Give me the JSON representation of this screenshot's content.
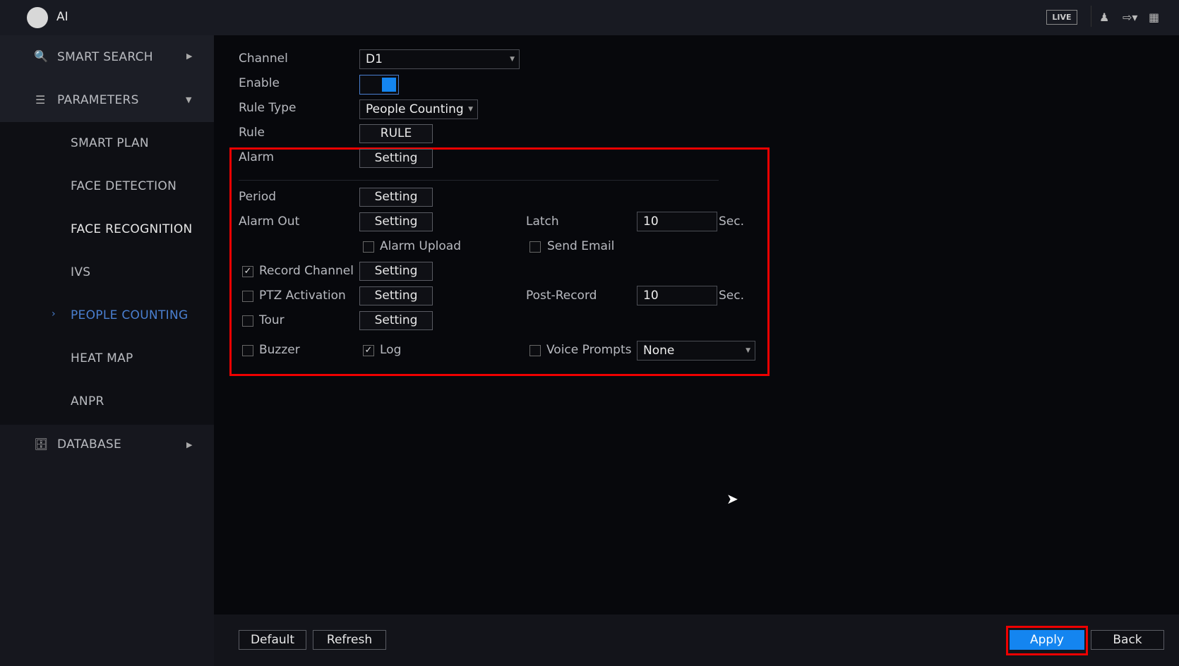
{
  "header": {
    "title": "AI",
    "live_label": "LIVE",
    "icons": [
      "user-icon",
      "logout-icon",
      "grid-icon"
    ]
  },
  "sidebar": {
    "smart_search": "SMART SEARCH",
    "parameters": "PARAMETERS",
    "sub_items": [
      "SMART PLAN",
      "FACE DETECTION",
      "FACE RECOGNITION",
      "IVS",
      "PEOPLE COUNTING",
      "HEAT MAP",
      "ANPR"
    ],
    "active_item": "PEOPLE COUNTING",
    "database": "DATABASE"
  },
  "form": {
    "channel_label": "Channel",
    "channel_value": "D1",
    "enable_label": "Enable",
    "enable_on": true,
    "rule_type_label": "Rule Type",
    "rule_type_value": "People Counting",
    "rule_label": "Rule",
    "rule_button": "RULE",
    "alarm_label": "Alarm",
    "setting": "Setting",
    "period_label": "Period",
    "alarm_out_label": "Alarm Out",
    "latch_label": "Latch",
    "latch_value": "10",
    "sec": "Sec.",
    "alarm_upload_label": "Alarm Upload",
    "alarm_upload_checked": false,
    "send_email_label": "Send Email",
    "send_email_checked": false,
    "record_channel_label": "Record Channel",
    "record_channel_checked": true,
    "ptz_label": "PTZ Activation",
    "ptz_checked": false,
    "post_record_label": "Post-Record",
    "post_record_value": "10",
    "tour_label": "Tour",
    "tour_checked": false,
    "buzzer_label": "Buzzer",
    "buzzer_checked": false,
    "log_label": "Log",
    "log_checked": true,
    "voice_prompts_label": "Voice Prompts",
    "voice_prompts_checked": false,
    "voice_prompts_value": "None"
  },
  "footer": {
    "default": "Default",
    "refresh": "Refresh",
    "apply": "Apply",
    "back": "Back"
  },
  "colors": {
    "accent": "#1485f0",
    "highlight": "#e00000",
    "active_nav": "#4a7fd0"
  }
}
